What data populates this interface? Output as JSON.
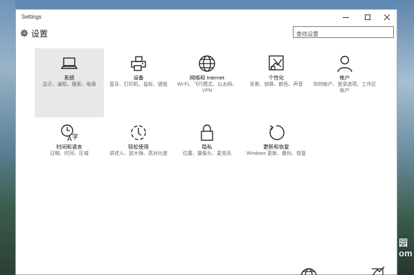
{
  "window": {
    "title": "Settings"
  },
  "header": {
    "title": "设置",
    "search_placeholder": "查找设置"
  },
  "tiles": [
    {
      "name": "系统",
      "desc": "显示、通知、搜索、电源",
      "icon": "laptop-icon"
    },
    {
      "name": "设备",
      "desc": "蓝牙、打印机、鼠标、键盘",
      "icon": "printer-icon"
    },
    {
      "name": "网络和 Internet",
      "desc": "Wi-Fi、飞行模式、以太网、VPN",
      "icon": "globe-icon"
    },
    {
      "name": "个性化",
      "desc": "背景、锁屏、颜色、声音",
      "icon": "personalization-icon"
    },
    {
      "name": "帐户",
      "desc": "你的帐户、登录选项、工作区帐户",
      "icon": "person-icon"
    },
    {
      "name": "时间和语言",
      "desc": "日期、时间、区域",
      "icon": "time-language-icon"
    },
    {
      "name": "轻松使用",
      "desc": "讲述人、放大镜、高对比度",
      "icon": "ease-of-access-icon"
    },
    {
      "name": "隐私",
      "desc": "位置、摄像头、麦克风",
      "icon": "lock-icon"
    },
    {
      "name": "更新和恢复",
      "desc": "Windows 更新、备份、恢复",
      "icon": "refresh-icon"
    }
  ],
  "desktop": {
    "watermark": "园\nom"
  }
}
